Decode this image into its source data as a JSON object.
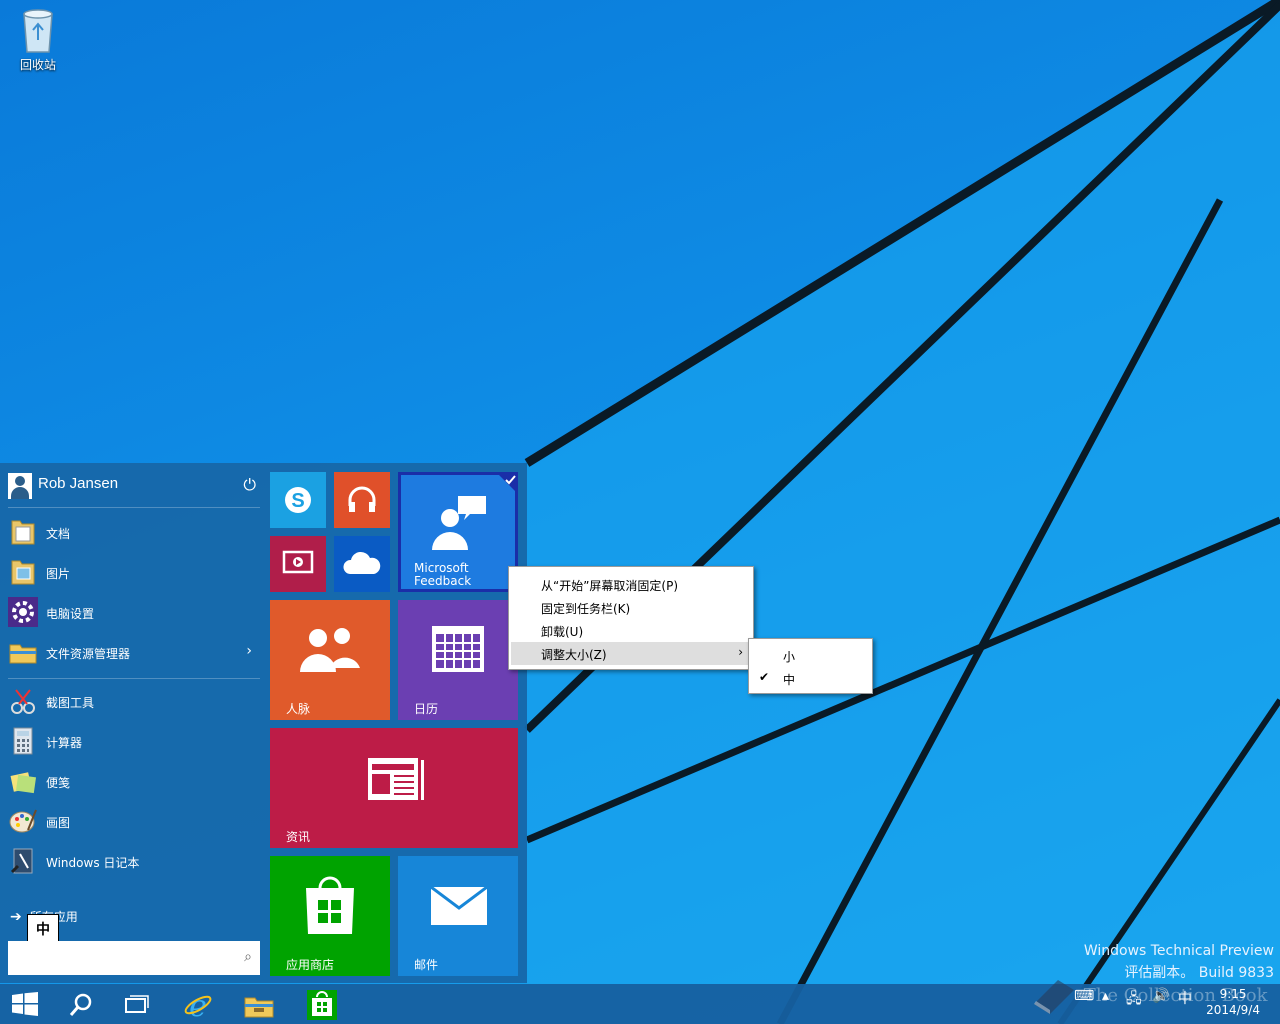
{
  "desktop": {
    "recycle_bin_label": "回收站",
    "build_line1": "Windows Technical Preview",
    "build_line2": "评估副本。 Build 9833"
  },
  "start_menu": {
    "user_name": "Rob Jansen",
    "items": [
      {
        "label": "文档",
        "icon": "folder-documents-icon"
      },
      {
        "label": "图片",
        "icon": "folder-pictures-icon"
      },
      {
        "label": "电脑设置",
        "icon": "gear-icon"
      },
      {
        "label": "文件资源管理器",
        "icon": "file-explorer-icon",
        "arrow": "›"
      },
      {
        "label": "截图工具",
        "icon": "snipping-tool-icon"
      },
      {
        "label": "计算器",
        "icon": "calculator-icon"
      },
      {
        "label": "便笺",
        "icon": "sticky-notes-icon"
      },
      {
        "label": "画图",
        "icon": "paint-icon"
      },
      {
        "label": "Windows 日记本",
        "icon": "journal-icon"
      }
    ],
    "all_apps_label": "所有应用",
    "ime_indicator": "中",
    "search_placeholder": ""
  },
  "tiles": {
    "feedback": "Microsoft Feedback",
    "people": "人脉",
    "calendar": "日历",
    "news": "资讯",
    "store": "应用商店",
    "mail": "邮件"
  },
  "context_menu": {
    "items": [
      "从“开始”屏幕取消固定(P)",
      "固定到任务栏(K)",
      "卸载(U)",
      "调整大小(Z)"
    ],
    "submenu_arrow": "›",
    "resize_options": [
      "小",
      "中"
    ],
    "checkmark": "✔"
  },
  "taskbar": {
    "time": "9:15",
    "date": "2014/9/4",
    "ime": "中"
  },
  "watermark": "The Collection Book",
  "colors": {
    "skype": "#1ba1e2",
    "music": "#e0502a",
    "video": "#b01e4a",
    "onedrive": "#0a5bc4",
    "feedback": "#1e7be0",
    "people": "#e05a2b",
    "calendar": "#6b3fb2",
    "news": "#bd1c47",
    "store": "#00a300",
    "mail": "#1786d8"
  }
}
